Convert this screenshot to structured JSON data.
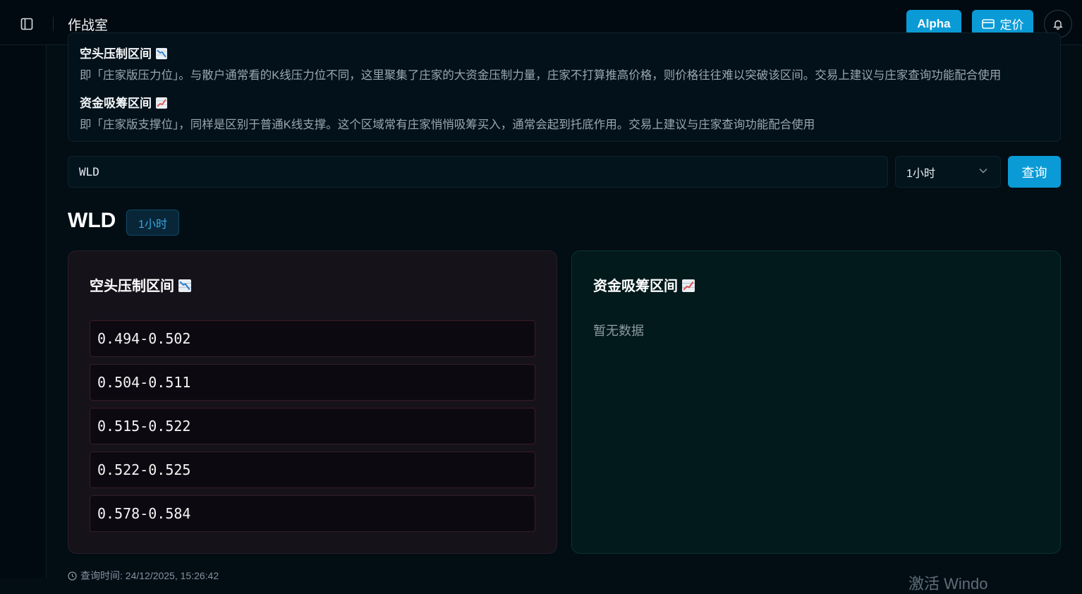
{
  "header": {
    "title": "作战室",
    "alpha_label": "Alpha",
    "pricing_label": "定价"
  },
  "info": {
    "bear_title": "空头压制区间",
    "bear_desc": "即「庄家版压力位」。与散户通常看的K线压力位不同，这里聚集了庄家的大资金压制力量，庄家不打算推高价格，则价格往往难以突破该区间。交易上建议与庄家查询功能配合使用",
    "bull_title": "资金吸筹区间",
    "bull_desc": "即「庄家版支撑位」，同样是区别于普通K线支撑。这个区域常有庄家悄悄吸筹买入，通常会起到托底作用。交易上建议与庄家查询功能配合使用"
  },
  "search": {
    "value": "WLD",
    "interval": "1小时",
    "query_label": "查询"
  },
  "result": {
    "symbol": "WLD",
    "interval_badge": "1小时",
    "bear_card_title": "空头压制区间",
    "bear_ranges": [
      "0.494-0.502",
      "0.504-0.511",
      "0.515-0.522",
      "0.522-0.525",
      "0.578-0.584"
    ],
    "bull_card_title": "资金吸筹区间",
    "bull_empty": "暂无数据"
  },
  "footer": {
    "query_time": "查询时间: 24/12/2025, 15:26:42",
    "cut_text": "激活 Windo"
  },
  "icons": {
    "bear_emoji": "chart-decreasing-icon",
    "bull_emoji": "chart-increasing-icon"
  },
  "colors": {
    "accent": "#0a9bd6",
    "background": "#020d14",
    "bear_card": "#15121a",
    "bull_card": "#021a1c"
  }
}
